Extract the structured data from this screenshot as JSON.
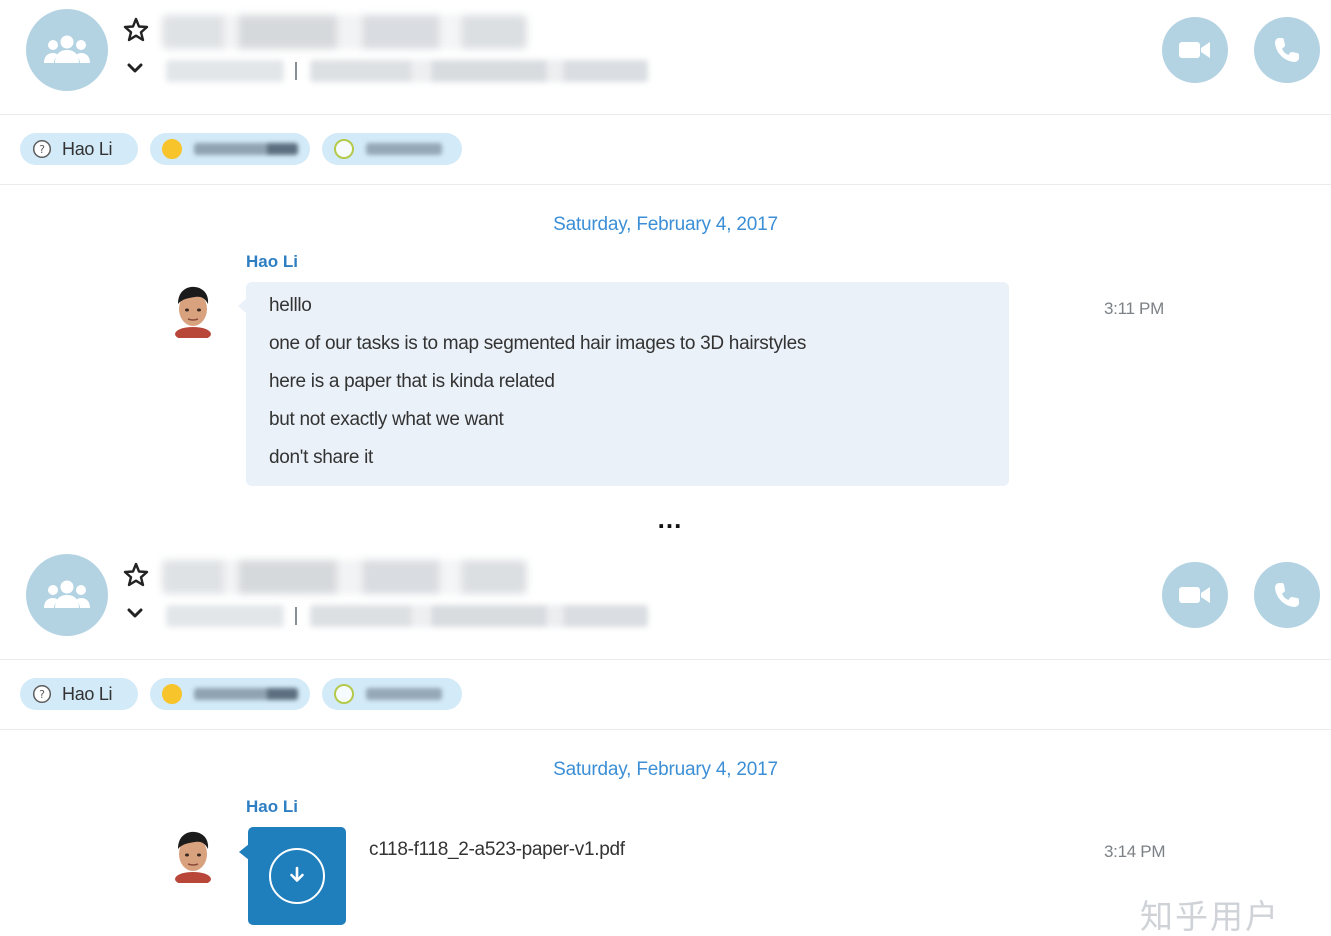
{
  "conversations": [
    {
      "header": {
        "icons": {
          "avatar": "group-people-icon",
          "favorite": "star-outline-icon",
          "expand": "chevron-down-icon",
          "video": "video-camera-icon",
          "call": "phone-icon"
        }
      },
      "participants": [
        {
          "name": "Hao Li",
          "status_icon": "away-clock-icon"
        },
        {
          "name": "",
          "status_icon": "away-yellow-dot"
        },
        {
          "name": "",
          "status_icon": "offline-ring"
        }
      ],
      "date": "Saturday, February 4, 2017",
      "message": {
        "sender": "Hao Li",
        "lines": [
          "helllo",
          "one of our tasks is to map segmented hair images to 3D hairstyles",
          "here is a paper that is kinda related",
          "but not exactly what we want",
          "don't share it"
        ],
        "time": "3:11 PM"
      }
    },
    {
      "header": {
        "icons": {
          "avatar": "group-people-icon",
          "favorite": "star-outline-icon",
          "expand": "chevron-down-icon",
          "video": "video-camera-icon",
          "call": "phone-icon"
        }
      },
      "participants": [
        {
          "name": "Hao Li",
          "status_icon": "away-clock-icon"
        },
        {
          "name": "",
          "status_icon": "away-yellow-dot"
        },
        {
          "name": "",
          "status_icon": "offline-ring"
        }
      ],
      "date": "Saturday, February 4, 2017",
      "message": {
        "sender": "Hao Li",
        "file_name": "c118-f118_2-a523-paper-v1.pdf",
        "file_icon": "download-icon",
        "time": "3:14 PM"
      }
    }
  ],
  "separator": "...",
  "watermark": "知乎用户",
  "colors": {
    "accent_light": "#b3d3e3",
    "chip_bg": "#d3eaf8",
    "link_blue": "#3c8fd6",
    "sender_blue": "#2d7ec2",
    "file_tile": "#1f7fbd",
    "bubble_bg": "#eaf1f8"
  }
}
